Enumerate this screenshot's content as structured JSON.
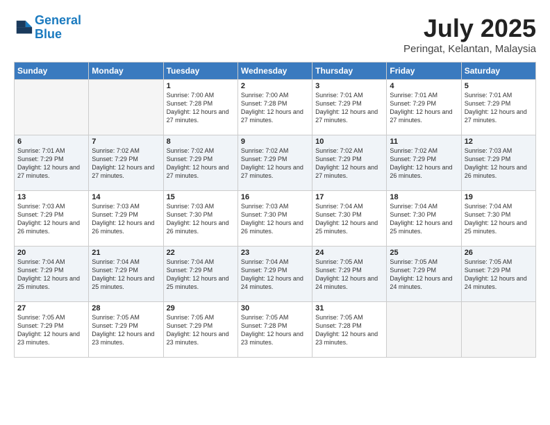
{
  "header": {
    "logo_line1": "General",
    "logo_line2": "Blue",
    "month": "July 2025",
    "location": "Peringat, Kelantan, Malaysia"
  },
  "weekdays": [
    "Sunday",
    "Monday",
    "Tuesday",
    "Wednesday",
    "Thursday",
    "Friday",
    "Saturday"
  ],
  "weeks": [
    [
      {
        "day": "",
        "content": ""
      },
      {
        "day": "",
        "content": ""
      },
      {
        "day": "1",
        "content": "Sunrise: 7:00 AM\nSunset: 7:28 PM\nDaylight: 12 hours\nand 27 minutes."
      },
      {
        "day": "2",
        "content": "Sunrise: 7:00 AM\nSunset: 7:28 PM\nDaylight: 12 hours\nand 27 minutes."
      },
      {
        "day": "3",
        "content": "Sunrise: 7:01 AM\nSunset: 7:29 PM\nDaylight: 12 hours\nand 27 minutes."
      },
      {
        "day": "4",
        "content": "Sunrise: 7:01 AM\nSunset: 7:29 PM\nDaylight: 12 hours\nand 27 minutes."
      },
      {
        "day": "5",
        "content": "Sunrise: 7:01 AM\nSunset: 7:29 PM\nDaylight: 12 hours\nand 27 minutes."
      }
    ],
    [
      {
        "day": "6",
        "content": "Sunrise: 7:01 AM\nSunset: 7:29 PM\nDaylight: 12 hours\nand 27 minutes."
      },
      {
        "day": "7",
        "content": "Sunrise: 7:02 AM\nSunset: 7:29 PM\nDaylight: 12 hours\nand 27 minutes."
      },
      {
        "day": "8",
        "content": "Sunrise: 7:02 AM\nSunset: 7:29 PM\nDaylight: 12 hours\nand 27 minutes."
      },
      {
        "day": "9",
        "content": "Sunrise: 7:02 AM\nSunset: 7:29 PM\nDaylight: 12 hours\nand 27 minutes."
      },
      {
        "day": "10",
        "content": "Sunrise: 7:02 AM\nSunset: 7:29 PM\nDaylight: 12 hours\nand 27 minutes."
      },
      {
        "day": "11",
        "content": "Sunrise: 7:02 AM\nSunset: 7:29 PM\nDaylight: 12 hours\nand 26 minutes."
      },
      {
        "day": "12",
        "content": "Sunrise: 7:03 AM\nSunset: 7:29 PM\nDaylight: 12 hours\nand 26 minutes."
      }
    ],
    [
      {
        "day": "13",
        "content": "Sunrise: 7:03 AM\nSunset: 7:29 PM\nDaylight: 12 hours\nand 26 minutes."
      },
      {
        "day": "14",
        "content": "Sunrise: 7:03 AM\nSunset: 7:29 PM\nDaylight: 12 hours\nand 26 minutes."
      },
      {
        "day": "15",
        "content": "Sunrise: 7:03 AM\nSunset: 7:30 PM\nDaylight: 12 hours\nand 26 minutes."
      },
      {
        "day": "16",
        "content": "Sunrise: 7:03 AM\nSunset: 7:30 PM\nDaylight: 12 hours\nand 26 minutes."
      },
      {
        "day": "17",
        "content": "Sunrise: 7:04 AM\nSunset: 7:30 PM\nDaylight: 12 hours\nand 25 minutes."
      },
      {
        "day": "18",
        "content": "Sunrise: 7:04 AM\nSunset: 7:30 PM\nDaylight: 12 hours\nand 25 minutes."
      },
      {
        "day": "19",
        "content": "Sunrise: 7:04 AM\nSunset: 7:30 PM\nDaylight: 12 hours\nand 25 minutes."
      }
    ],
    [
      {
        "day": "20",
        "content": "Sunrise: 7:04 AM\nSunset: 7:29 PM\nDaylight: 12 hours\nand 25 minutes."
      },
      {
        "day": "21",
        "content": "Sunrise: 7:04 AM\nSunset: 7:29 PM\nDaylight: 12 hours\nand 25 minutes."
      },
      {
        "day": "22",
        "content": "Sunrise: 7:04 AM\nSunset: 7:29 PM\nDaylight: 12 hours\nand 25 minutes."
      },
      {
        "day": "23",
        "content": "Sunrise: 7:04 AM\nSunset: 7:29 PM\nDaylight: 12 hours\nand 24 minutes."
      },
      {
        "day": "24",
        "content": "Sunrise: 7:05 AM\nSunset: 7:29 PM\nDaylight: 12 hours\nand 24 minutes."
      },
      {
        "day": "25",
        "content": "Sunrise: 7:05 AM\nSunset: 7:29 PM\nDaylight: 12 hours\nand 24 minutes."
      },
      {
        "day": "26",
        "content": "Sunrise: 7:05 AM\nSunset: 7:29 PM\nDaylight: 12 hours\nand 24 minutes."
      }
    ],
    [
      {
        "day": "27",
        "content": "Sunrise: 7:05 AM\nSunset: 7:29 PM\nDaylight: 12 hours\nand 23 minutes."
      },
      {
        "day": "28",
        "content": "Sunrise: 7:05 AM\nSunset: 7:29 PM\nDaylight: 12 hours\nand 23 minutes."
      },
      {
        "day": "29",
        "content": "Sunrise: 7:05 AM\nSunset: 7:29 PM\nDaylight: 12 hours\nand 23 minutes."
      },
      {
        "day": "30",
        "content": "Sunrise: 7:05 AM\nSunset: 7:28 PM\nDaylight: 12 hours\nand 23 minutes."
      },
      {
        "day": "31",
        "content": "Sunrise: 7:05 AM\nSunset: 7:28 PM\nDaylight: 12 hours\nand 23 minutes."
      },
      {
        "day": "",
        "content": ""
      },
      {
        "day": "",
        "content": ""
      }
    ]
  ]
}
